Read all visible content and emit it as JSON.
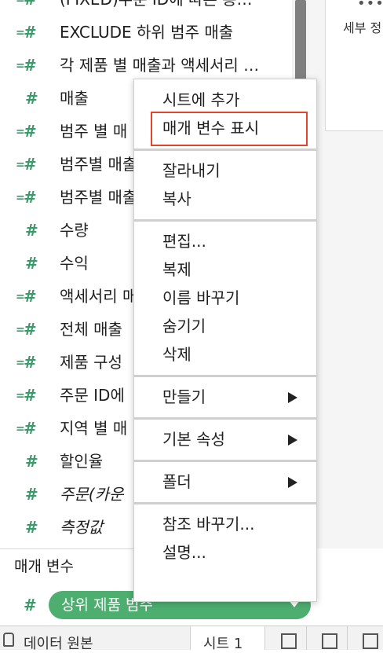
{
  "data_pane": {
    "measures": [
      {
        "label": "(FIXED)주문 ID에 따른 총…",
        "calc": true,
        "italic": false
      },
      {
        "label": "EXCLUDE 하위 범주 매출",
        "calc": true,
        "italic": false
      },
      {
        "label": "각 제품 별 매출과 액세서리 …",
        "calc": true,
        "italic": false
      },
      {
        "label": "매출",
        "calc": false,
        "italic": false
      },
      {
        "label": "범주 별 매",
        "calc": true,
        "italic": false
      },
      {
        "label": "범주별 매출",
        "calc": true,
        "italic": false
      },
      {
        "label": "범주별 매출",
        "calc": true,
        "italic": false
      },
      {
        "label": "수량",
        "calc": false,
        "italic": false
      },
      {
        "label": "수익",
        "calc": false,
        "italic": false
      },
      {
        "label": "액세서리 매",
        "calc": true,
        "italic": false
      },
      {
        "label": "전체 매출",
        "calc": true,
        "italic": false
      },
      {
        "label": "제품 구성",
        "calc": true,
        "italic": false
      },
      {
        "label": "주문 ID에",
        "calc": true,
        "italic": false
      },
      {
        "label": "지역 별 매",
        "calc": true,
        "italic": false
      },
      {
        "label": "할인율",
        "calc": false,
        "italic": false
      },
      {
        "label": "주문(카운",
        "calc": false,
        "italic": true
      },
      {
        "label": "측정값",
        "calc": false,
        "italic": true
      }
    ],
    "parameters_header": "매개 변수",
    "parameter": {
      "label": "상위 제품 범주"
    }
  },
  "right_panel": {
    "dots": "•••",
    "detail_label": "세부 정…"
  },
  "context_menu": {
    "groups": [
      [
        {
          "label": "시트에 추가",
          "submenu": false
        },
        {
          "label": "매개 변수 표시",
          "submenu": false,
          "highlighted": true
        }
      ],
      [
        {
          "label": "잘라내기",
          "submenu": false
        },
        {
          "label": "복사",
          "submenu": false
        }
      ],
      [
        {
          "label": "편집...",
          "submenu": false
        },
        {
          "label": "복제",
          "submenu": false
        },
        {
          "label": "이름 바꾸기",
          "submenu": false
        },
        {
          "label": "숨기기",
          "submenu": false
        },
        {
          "label": "삭제",
          "submenu": false
        }
      ],
      [
        {
          "label": "만들기",
          "submenu": true
        }
      ],
      [
        {
          "label": "기본 속성",
          "submenu": true
        }
      ],
      [
        {
          "label": "폴더",
          "submenu": true
        }
      ],
      [
        {
          "label": "참조 바꾸기...",
          "submenu": false
        },
        {
          "label": "설명...",
          "submenu": false
        }
      ]
    ]
  },
  "tab_bar": {
    "data_source_label": "데이터 원본",
    "sheet_tab_label": "시트 1"
  },
  "colors": {
    "field_icon": "#3a9a6a",
    "pill": "#4dae70",
    "highlight_box": "#e2452a"
  }
}
